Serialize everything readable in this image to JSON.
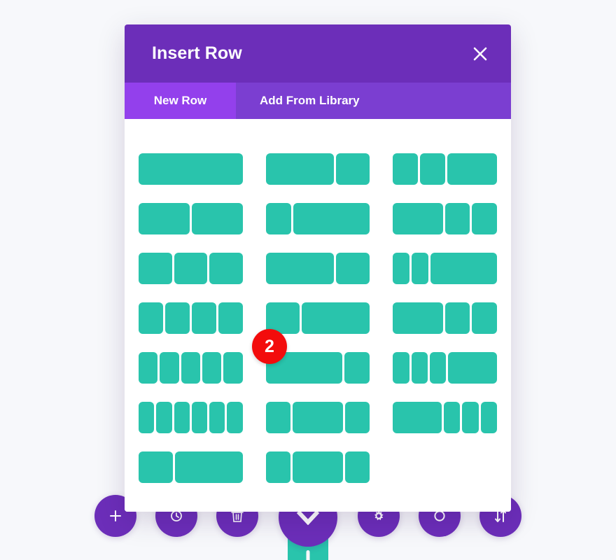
{
  "modal": {
    "title": "Insert Row",
    "close_icon": "close-icon",
    "tabs": [
      {
        "label": "New Row",
        "active": true
      },
      {
        "label": "Add From Library",
        "active": false
      }
    ],
    "accent_purple": "#6C2EB9",
    "tab_active_purple": "#9340EC",
    "tab_inactive_purple": "#7B3ED1",
    "block_teal": "#29C4AC",
    "badge_red": "#F30C0C"
  },
  "layouts": [
    {
      "name": "1 column (full width)",
      "widths": [
        12
      ]
    },
    {
      "name": "2 equal columns",
      "widths": [
        6,
        6
      ]
    },
    {
      "name": "3 equal columns",
      "widths": [
        4,
        4,
        4
      ]
    },
    {
      "name": "4 equal columns",
      "widths": [
        3,
        3,
        3,
        3
      ]
    },
    {
      "name": "5 equal columns",
      "widths": [
        2.4,
        2.4,
        2.4,
        2.4,
        2.4
      ]
    },
    {
      "name": "6 equal columns",
      "widths": [
        2,
        2,
        2,
        2,
        2,
        2
      ]
    },
    {
      "name": "1/3 + 2/3",
      "widths": [
        4,
        8
      ]
    },
    {
      "name": "2/3 + 1/3",
      "widths": [
        8,
        4
      ]
    },
    {
      "name": "1/4 + 3/4",
      "widths": [
        3,
        9
      ]
    },
    {
      "name": "2/3 + 1/3",
      "widths": [
        8,
        4
      ]
    },
    {
      "name": "1/3 + 2/3",
      "widths": [
        4,
        8
      ]
    },
    {
      "name": "3/4 + 1/4",
      "widths": [
        9,
        3
      ]
    },
    {
      "name": "1/4 + 1/2 + 1/4",
      "widths": [
        3,
        6,
        3
      ]
    },
    {
      "name": "1/4 + 1/2 + 1/4",
      "widths": [
        3,
        6,
        3
      ]
    },
    {
      "name": "1/4 + 1/4 + 1/2",
      "widths": [
        3,
        3,
        6
      ]
    },
    {
      "name": "1/2 + 1/4 + 1/4",
      "widths": [
        6,
        3,
        3
      ]
    },
    {
      "name": "1/6 + 1/6 + 2/3",
      "widths": [
        2,
        2,
        8
      ]
    },
    {
      "name": "1/2 + 1/4 + 1/4",
      "widths": [
        6,
        3,
        3
      ]
    },
    {
      "name": "1/6 + 1/6 + 1/6 + 1/2",
      "widths": [
        2,
        2,
        2,
        6
      ]
    },
    {
      "name": "1/2 + 1/6 + 1/6 + 1/6",
      "widths": [
        6,
        2,
        2,
        2
      ]
    }
  ],
  "badge": {
    "number": "2"
  },
  "toolbar": {
    "buttons": [
      {
        "icon": "plus-icon",
        "name": "add-section-button"
      },
      {
        "icon": "clock-undo-icon",
        "name": "history-button"
      },
      {
        "icon": "trash-icon",
        "name": "delete-button"
      },
      {
        "icon": "chevron-down-icon",
        "name": "collapse-button"
      },
      {
        "icon": "gear-icon",
        "name": "settings-button"
      },
      {
        "icon": "clock-icon",
        "name": "revisions-button"
      },
      {
        "icon": "sort-arrows-icon",
        "name": "reorder-button"
      }
    ]
  }
}
